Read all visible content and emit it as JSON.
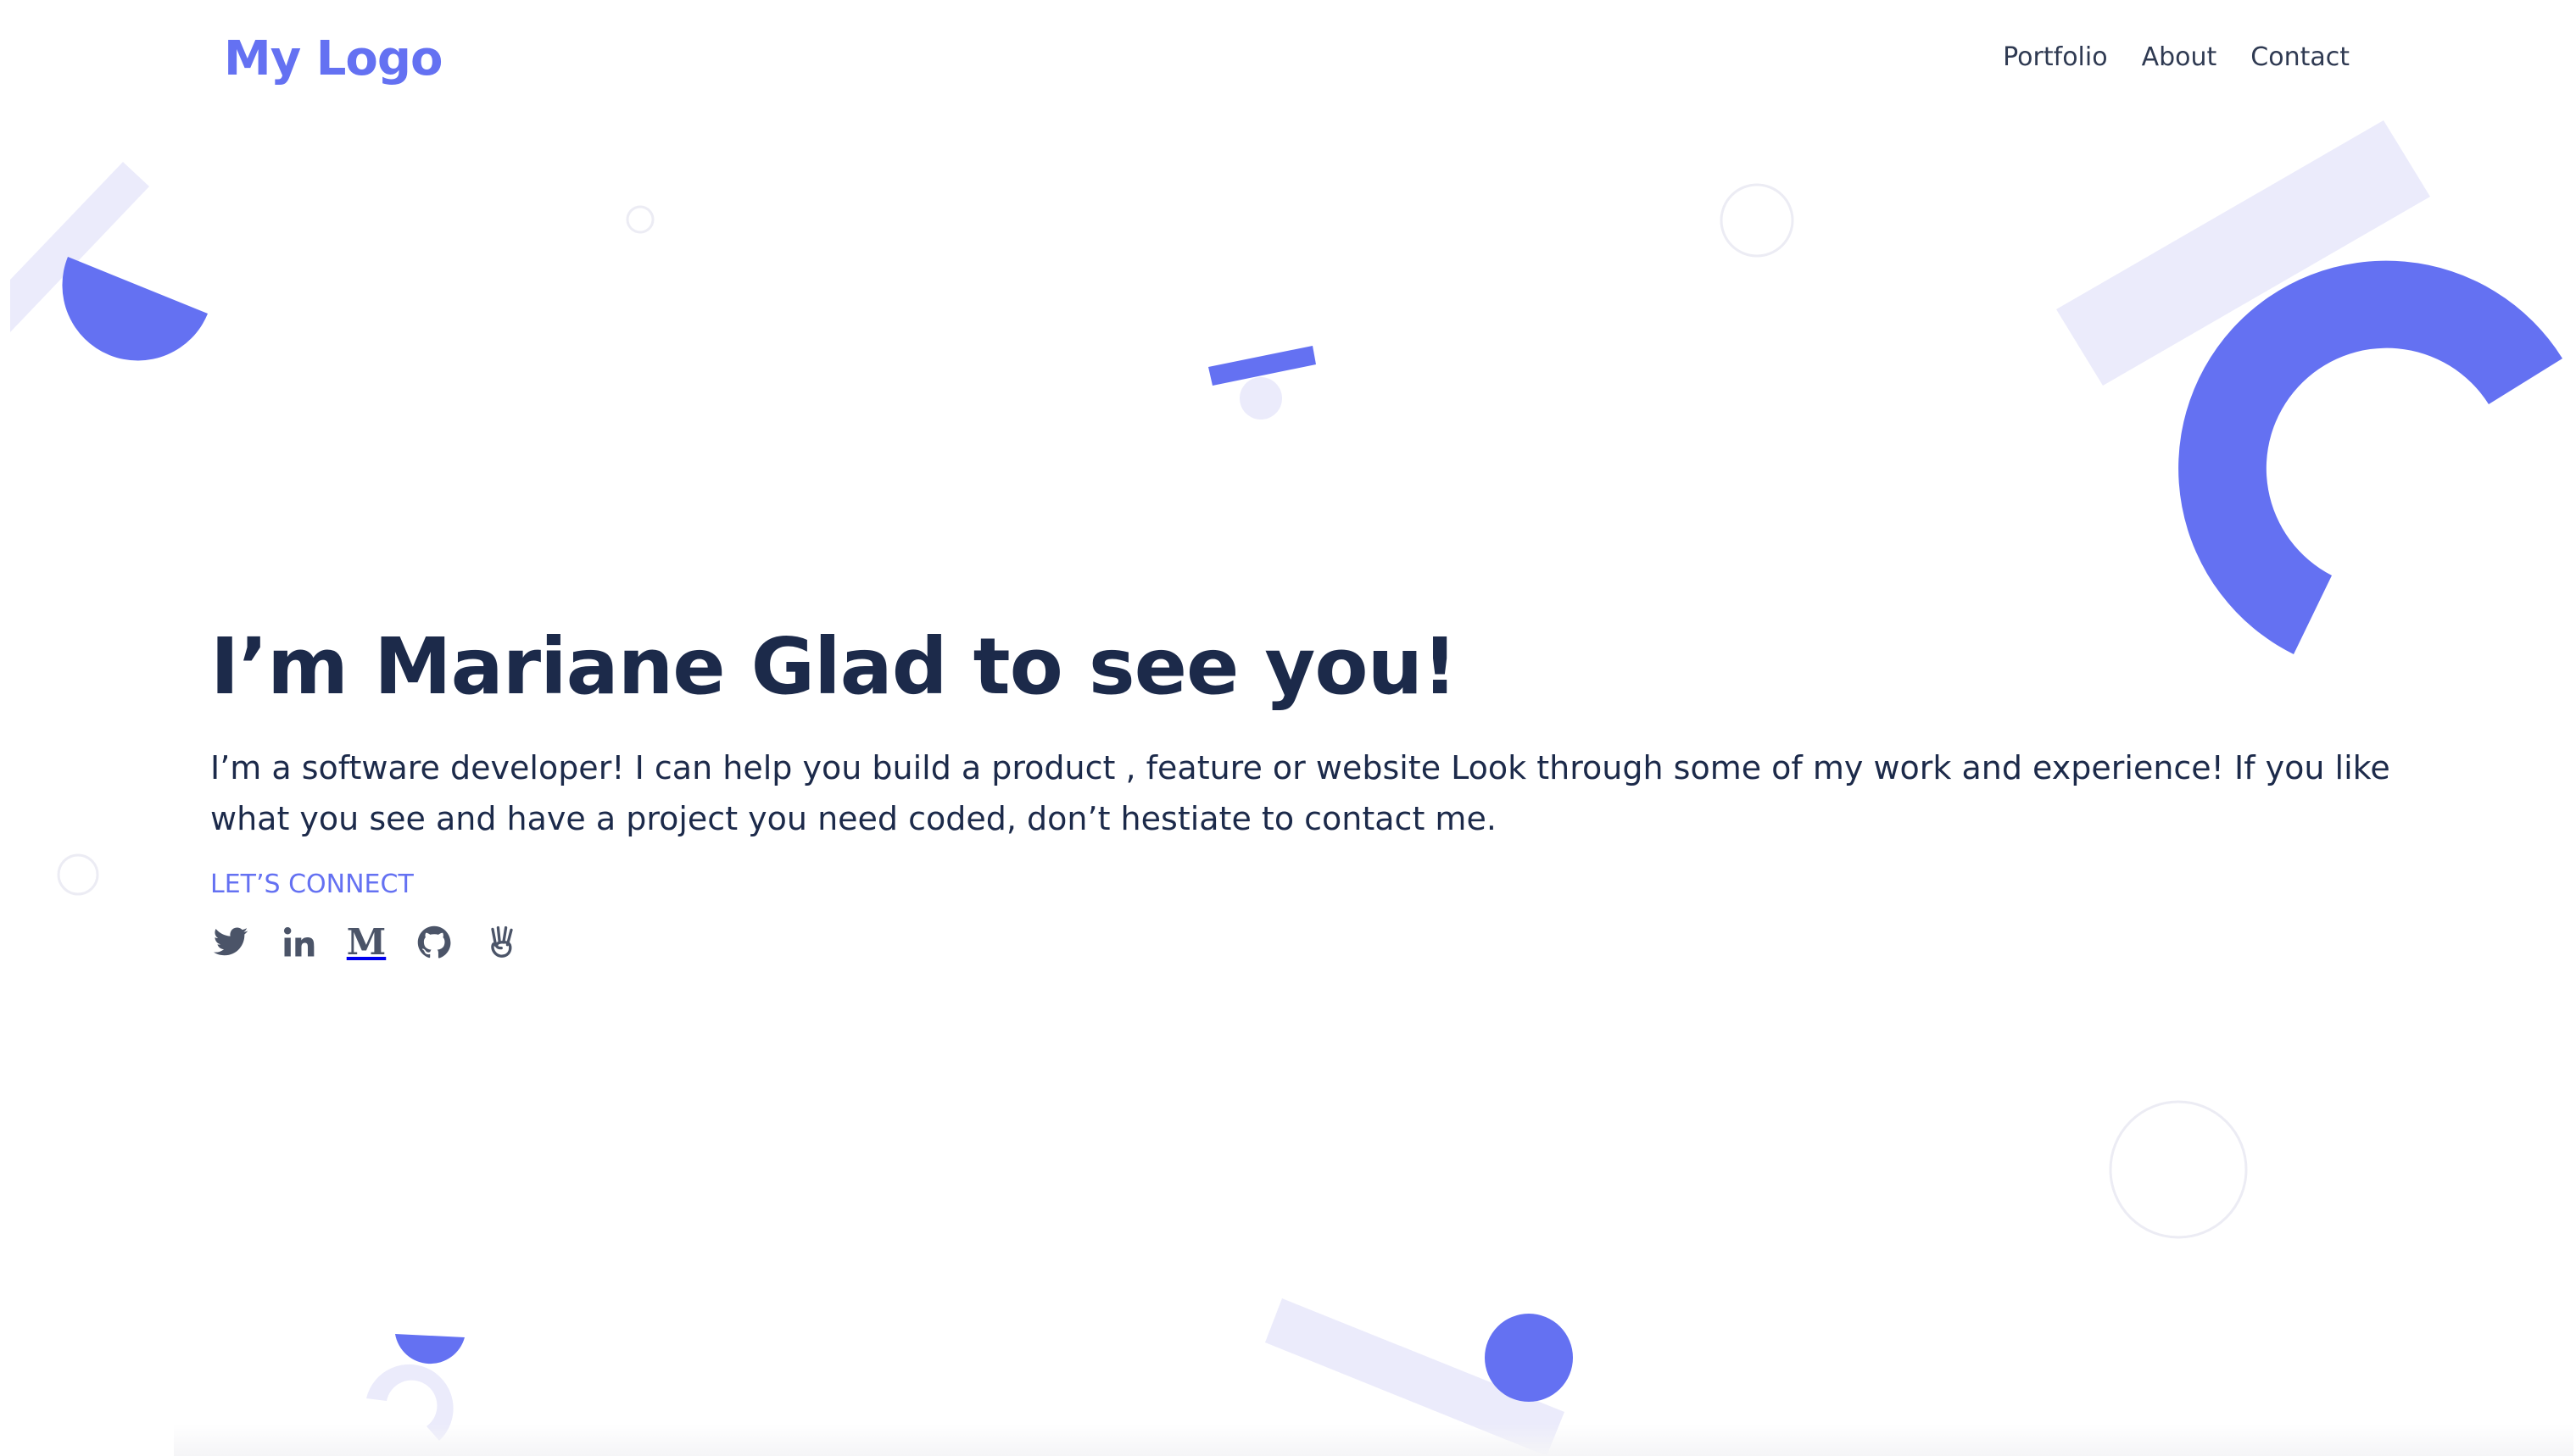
{
  "colors": {
    "accent": "#6471f2",
    "accent_light": "#e9e9fb",
    "heading": "#1c2a4a",
    "nav_text": "#2f3a52",
    "icon": "#4b5468"
  },
  "header": {
    "logo": "My Logo",
    "nav": [
      {
        "label": "Portfolio"
      },
      {
        "label": "About"
      },
      {
        "label": "Contact"
      }
    ]
  },
  "hero": {
    "title": "I’m Mariane Glad to see you!",
    "description": "I’m a software developer! I can help you build a product , feature or website Look through some of my work and experience! If you like what you see and have a project you need coded, don’t hestiate to contact me.",
    "connect_label": "LET’S CONNECT",
    "socials": [
      {
        "name": "twitter",
        "icon": "twitter-icon"
      },
      {
        "name": "linkedin",
        "icon": "linkedin-icon"
      },
      {
        "name": "medium",
        "icon": "medium-icon"
      },
      {
        "name": "github",
        "icon": "github-icon"
      },
      {
        "name": "angellist",
        "icon": "angellist-icon"
      }
    ]
  },
  "icons": {
    "linkedin_text": "in",
    "medium_text": "M",
    "angellist_text": "✌"
  }
}
